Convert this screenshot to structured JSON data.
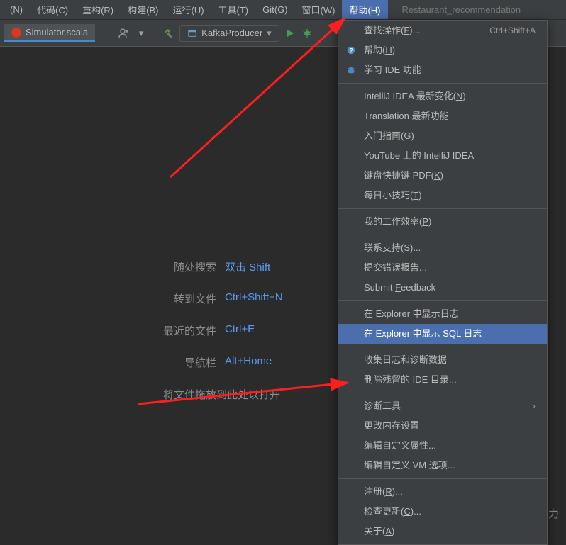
{
  "menubar": {
    "items": [
      "(N)",
      "代码(C)",
      "重构(R)",
      "构建(B)",
      "运行(U)",
      "工具(T)",
      "Git(G)",
      "窗口(W)",
      "帮助(H)"
    ],
    "title": "Restaurant_recommendation"
  },
  "toolbar": {
    "tab_label": "Simulator.scala",
    "run_config": "KafkaProducer"
  },
  "hints": {
    "rows": [
      {
        "label": "随处搜索",
        "key": "双击 Shift"
      },
      {
        "label": "转到文件",
        "key": "Ctrl+Shift+N"
      },
      {
        "label": "最近的文件",
        "key": "Ctrl+E"
      },
      {
        "label": "导航栏",
        "key": "Alt+Home"
      }
    ],
    "drop": "将文件拖放到此处以打开"
  },
  "help_menu": {
    "groups": [
      [
        {
          "label": "查找操作(F)...",
          "shortcut": "Ctrl+Shift+A"
        },
        {
          "label": "帮助(H)",
          "icon": "help"
        },
        {
          "label": "学习 IDE 功能",
          "icon": "cap"
        }
      ],
      [
        {
          "label": "IntelliJ IDEA 最新变化(N)"
        },
        {
          "label": "Translation 最新功能"
        },
        {
          "label": "入门指南(G)"
        },
        {
          "label": "YouTube 上的 IntelliJ IDEA"
        },
        {
          "label": "键盘快捷键 PDF(K)"
        },
        {
          "label": "每日小技巧(T)"
        }
      ],
      [
        {
          "label": "我的工作效率(P)"
        }
      ],
      [
        {
          "label": "联系支持(S)..."
        },
        {
          "label": "提交错误报告..."
        },
        {
          "label": "Submit Feedback"
        }
      ],
      [
        {
          "label": "在 Explorer 中显示日志"
        },
        {
          "label": "在 Explorer 中显示 SQL 日志",
          "highlight": true
        }
      ],
      [
        {
          "label": "收集日志和诊断数据"
        },
        {
          "label": "删除残留的 IDE 目录..."
        }
      ],
      [
        {
          "label": "诊断工具",
          "submenu": true
        },
        {
          "label": "更改内存设置"
        },
        {
          "label": "编辑自定义属性..."
        },
        {
          "label": "编辑自定义 VM 选项..."
        }
      ],
      [
        {
          "label": "注册(R)..."
        },
        {
          "label": "检查更新(C)..."
        },
        {
          "label": "关于(A)"
        }
      ]
    ]
  },
  "watermark": "CSDN @严同学正在努力"
}
